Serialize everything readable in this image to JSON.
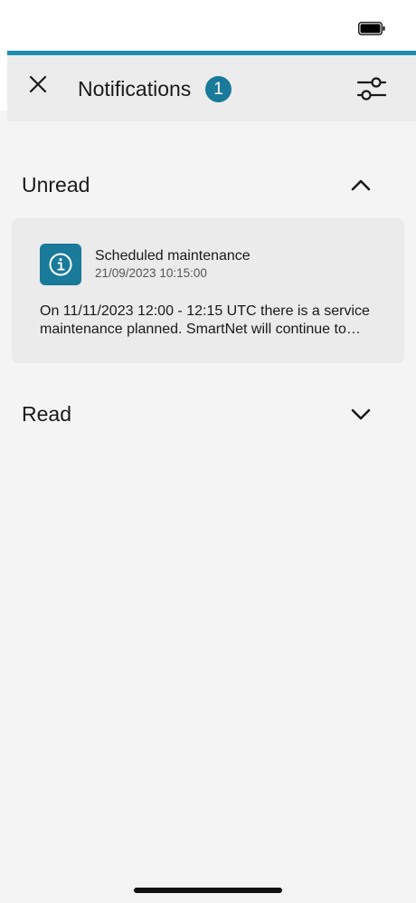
{
  "theme": {
    "accent": "#1a7a99",
    "accent_line": "#1e8fb3",
    "background": "#f4f4f4",
    "header_background": "#ececec",
    "card_background": "#ebebeb"
  },
  "status_bar": {
    "battery_icon": "battery-full-icon"
  },
  "header": {
    "close_icon": "close-icon",
    "title": "Notifications",
    "unread_count": "1",
    "filter_icon": "sliders-icon"
  },
  "sections": {
    "unread": {
      "title": "Unread",
      "expanded": true,
      "chevron_icon": "chevron-up-icon"
    },
    "read": {
      "title": "Read",
      "expanded": false,
      "chevron_icon": "chevron-down-icon"
    }
  },
  "notifications": [
    {
      "icon": "info-icon",
      "title": "Scheduled maintenance",
      "date": "21/09/2023 10:15:00",
      "body": "On 11/11/2023 12:00 - 12:15 UTC there is a service maintenance planned. SmartNet will continue to operate as usual during this time."
    }
  ]
}
